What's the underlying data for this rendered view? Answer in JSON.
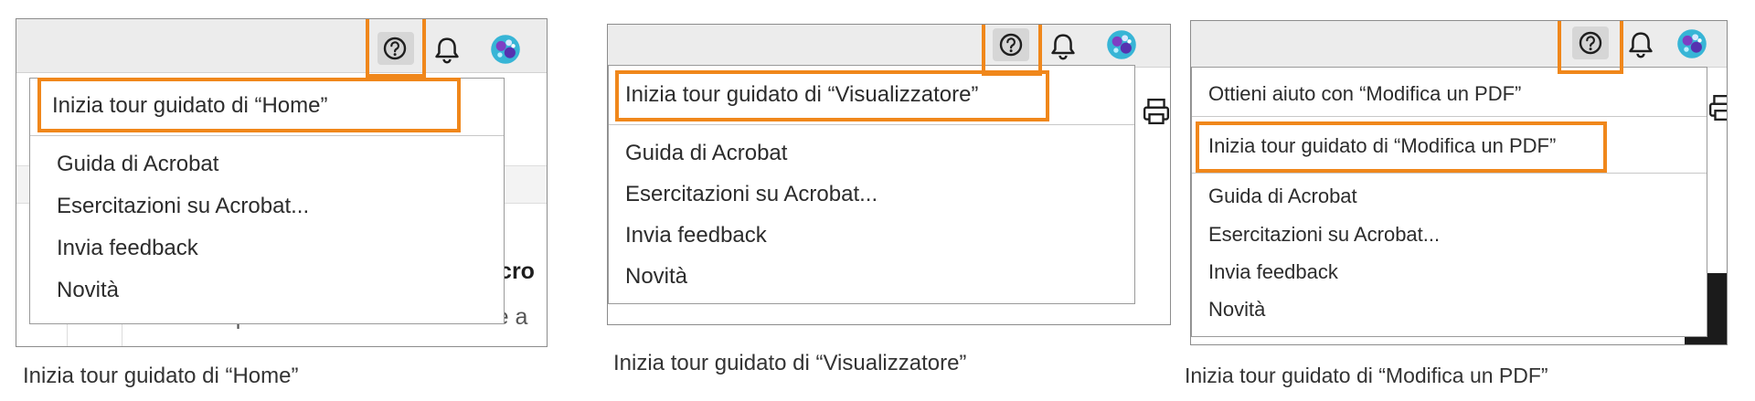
{
  "panels": [
    {
      "background_text": [
        "Acro",
        "Imposta Adobe Acrobat come a"
      ],
      "tour_item": "Inizia tour guidato di “Home”",
      "items": [
        "Guida di Acrobat",
        "Esercitazioni su Acrobat...",
        "Invia feedback",
        "Novità"
      ],
      "caption": "Inizia tour guidato di “Home”"
    },
    {
      "tour_item": "Inizia tour guidato di “Visualizzatore”",
      "items": [
        "Guida di Acrobat",
        "Esercitazioni su Acrobat...",
        "Invia feedback",
        "Novità"
      ],
      "caption": "Inizia tour guidato di “Visualizzatore”"
    },
    {
      "help_item": "Ottieni aiuto con “Modifica un PDF”",
      "tour_item": "Inizia tour guidato di “Modifica un PDF”",
      "items": [
        "Guida di Acrobat",
        "Esercitazioni su Acrobat...",
        "Invia feedback",
        "Novità"
      ],
      "caption": "Inizia tour guidato di “Modifica un PDF”"
    }
  ],
  "colors": {
    "highlight": "#f0871b",
    "toolbar": "#ececec"
  },
  "icons": [
    "help-icon",
    "bell-icon",
    "avatar",
    "print-icon"
  ]
}
